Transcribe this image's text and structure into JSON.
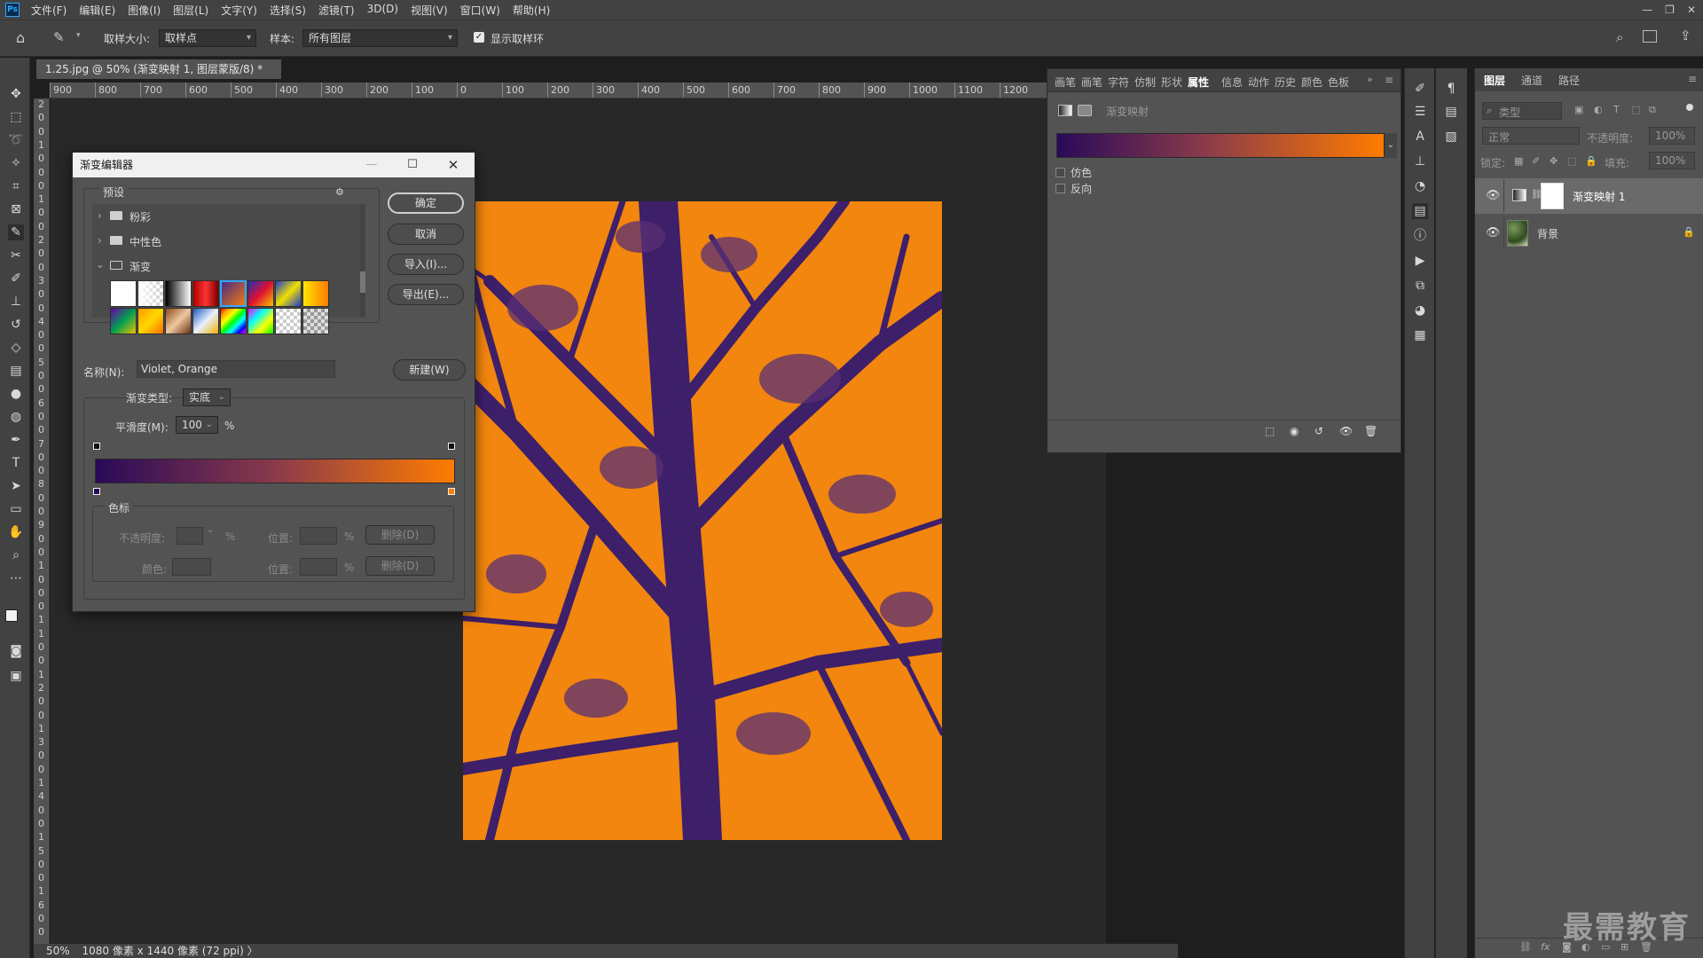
{
  "menubar": {
    "logo": "Ps",
    "items": [
      "文件(F)",
      "编辑(E)",
      "图像(I)",
      "图层(L)",
      "文字(Y)",
      "选择(S)",
      "滤镜(T)",
      "3D(D)",
      "视图(V)",
      "窗口(W)",
      "帮助(H)"
    ]
  },
  "options": {
    "sample_size_label": "取样大小:",
    "sample_size_value": "取样点",
    "sample_label": "样本:",
    "sample_value": "所有图层",
    "show_ring_label": "显示取样环"
  },
  "document": {
    "tab_title": "1.25.jpg @ 50% (渐变映射 1, 图层蒙版/8) *",
    "ruler_h": [
      "900",
      "800",
      "700",
      "600",
      "500",
      "400",
      "300",
      "200",
      "100",
      "0",
      "100",
      "200",
      "300",
      "400",
      "500",
      "600",
      "700",
      "800",
      "900",
      "1000",
      "1100",
      "1200"
    ],
    "ruler_v": [
      "2",
      "0",
      "0",
      "1",
      "0",
      "0",
      "0",
      "1",
      "0",
      "0",
      "2",
      "0",
      "0",
      "3",
      "0",
      "0",
      "4",
      "0",
      "0",
      "5",
      "0",
      "0",
      "6",
      "0",
      "0",
      "7",
      "0",
      "0",
      "8",
      "0",
      "0",
      "9",
      "0",
      "0",
      "1",
      "0",
      "0",
      "0",
      "1",
      "1",
      "0",
      "0",
      "1",
      "2",
      "0",
      "0",
      "1",
      "3",
      "0",
      "0",
      "1",
      "4",
      "0",
      "0",
      "1",
      "5",
      "0",
      "0",
      "1",
      "6",
      "0",
      "0"
    ],
    "status_zoom": "50%",
    "status_info": "1080 像素 x 1440 像素 (72 ppi)"
  },
  "dialog": {
    "title": "渐变编辑器",
    "presets_label": "预设",
    "folders": [
      "粉彩",
      "中性色",
      "渐变"
    ],
    "ok": "确定",
    "cancel": "取消",
    "import": "导入(I)...",
    "export": "导出(E)...",
    "name_label": "名称(N):",
    "name_value": "Violet, Orange",
    "new_button": "新建(W)",
    "gradient_type_label": "渐变类型:",
    "gradient_type_value": "实底",
    "smoothness_label": "平滑度(M):",
    "smoothness_value": "100",
    "percent": "%",
    "stops_label": "色标",
    "opacity_label": "不透明度:",
    "position_label": "位置:",
    "delete_label": "删除(D)",
    "color_label": "颜色:",
    "gradient_colors": [
      "#290a59",
      "#ff7c00"
    ]
  },
  "properties": {
    "tabs": [
      "画笔",
      "画笔",
      "字符",
      "仿制",
      "形状",
      "属性",
      "信息",
      "动作",
      "历史",
      "颜色",
      "色板"
    ],
    "active_tab": "属性",
    "title": "渐变映射",
    "dither_label": "仿色",
    "reverse_label": "反向"
  },
  "layers": {
    "tabs": [
      "图层",
      "通道",
      "路径"
    ],
    "filter_placeholder": "类型",
    "blend_mode": "正常",
    "opacity_label": "不透明度:",
    "opacity_value": "100%",
    "lock_label": "锁定:",
    "fill_label": "填充:",
    "fill_value": "100%",
    "rows": [
      {
        "name": "渐变映射 1",
        "selected": true
      },
      {
        "name": "背景",
        "selected": false
      }
    ]
  },
  "watermark": "最需教育",
  "colors": {
    "accent": "#31a8ff",
    "gradient_start": "#290a59",
    "gradient_end": "#ff7c00"
  }
}
